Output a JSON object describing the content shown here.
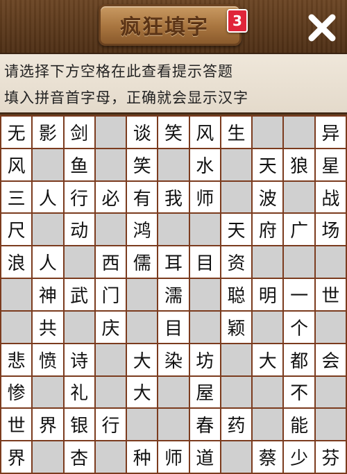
{
  "header": {
    "logo_text": "疯狂填字",
    "level": "3"
  },
  "hint": {
    "line1": "请选择下方空格在此查看提示答题",
    "line2": "填入拼音首字母，正确就会显示汉字"
  },
  "grid": [
    [
      "无",
      "影",
      "剑",
      "",
      "谈",
      "笑",
      "风",
      "生",
      "",
      "",
      "异"
    ],
    [
      "风",
      "",
      "鱼",
      "",
      "笑",
      "",
      "水",
      "",
      "天",
      "狼",
      "星"
    ],
    [
      "三",
      "人",
      "行",
      "必",
      "有",
      "我",
      "师",
      "",
      "波",
      "",
      "战"
    ],
    [
      "尺",
      "",
      "动",
      "",
      "鸿",
      "",
      "",
      "天",
      "府",
      "广",
      "场"
    ],
    [
      "浪",
      "人",
      "",
      "西",
      "儒",
      "耳",
      "目",
      "资",
      "",
      "",
      ""
    ],
    [
      "",
      "神",
      "武",
      "门",
      "",
      "濡",
      "",
      "聪",
      "明",
      "一",
      "世"
    ],
    [
      "",
      "共",
      "",
      "庆",
      "",
      "目",
      "",
      "颖",
      "",
      "个",
      ""
    ],
    [
      "悲",
      "愤",
      "诗",
      "",
      "大",
      "染",
      "坊",
      "",
      "大",
      "都",
      "会"
    ],
    [
      "惨",
      "",
      "礼",
      "",
      "大",
      "",
      "屋",
      "",
      "",
      "不",
      ""
    ],
    [
      "世",
      "界",
      "银",
      "行",
      "",
      "",
      "春",
      "药",
      "",
      "能",
      ""
    ],
    [
      "界",
      "",
      "杏",
      "",
      "种",
      "师",
      "道",
      "",
      "蔡",
      "少",
      "芬"
    ]
  ]
}
